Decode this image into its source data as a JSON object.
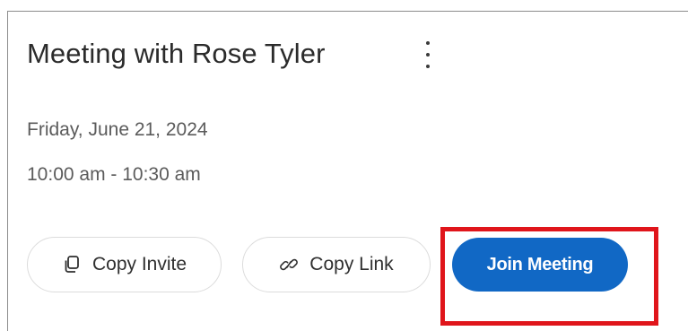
{
  "meeting": {
    "title": "Meeting with Rose Tyler",
    "date": "Friday, June 21, 2024",
    "time": "10:00 am - 10:30 am"
  },
  "actions": {
    "copy_invite_label": "Copy Invite",
    "copy_invite_icon": "copy-icon",
    "copy_link_label": "Copy Link",
    "copy_link_icon": "link-icon",
    "join_label": "Join Meeting",
    "more_icon": "more-vertical-icon"
  },
  "colors": {
    "primary": "#1168c5",
    "highlight": "#e0151b"
  }
}
